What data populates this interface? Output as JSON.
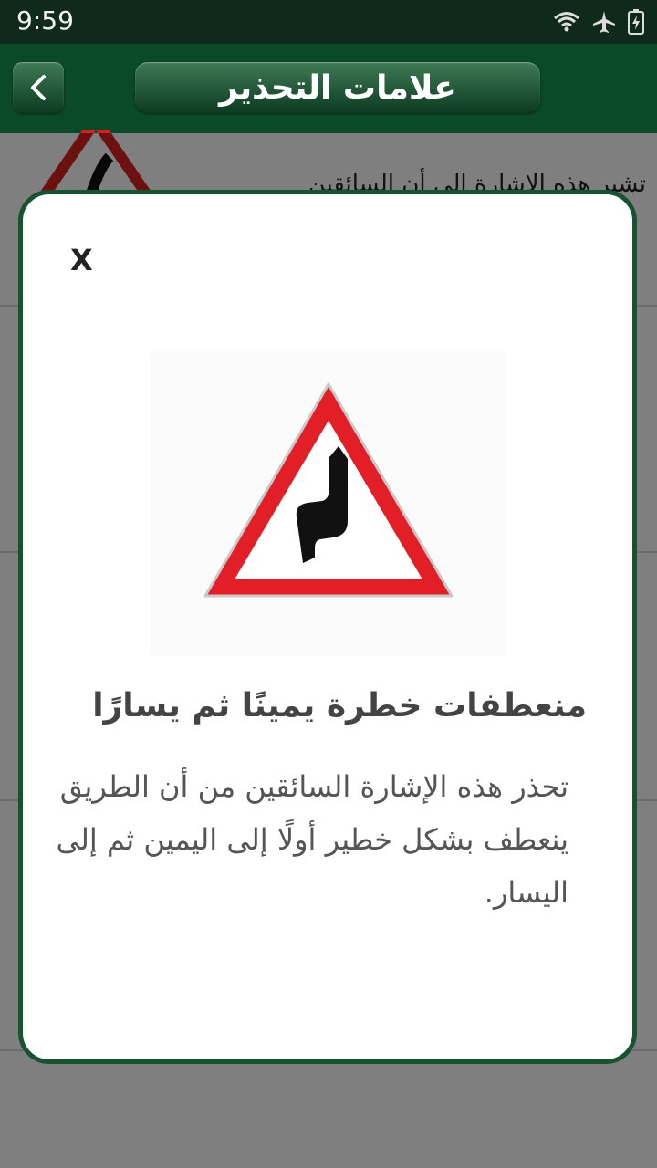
{
  "status_bar": {
    "time": "9:59",
    "icons": [
      "wifi-icon",
      "airplane-mode-icon",
      "battery-charging-icon"
    ]
  },
  "app_bar": {
    "title": "علامات التحذير",
    "back_icon": "chevron-left-icon",
    "color": "#0a4a28"
  },
  "background_list": {
    "items": [
      {
        "desc": "تشير هذه الإشارة إلى أن السائقين"
      },
      {
        "desc": ""
      },
      {
        "desc": ""
      },
      {
        "desc": ""
      }
    ]
  },
  "dialog": {
    "close_label": "X",
    "sign_icon": "double-curve-right-then-left-warning-sign",
    "title": "منعطفات خطرة يمينًا ثم يسارًا",
    "description": "تحذر هذه الإشارة السائقين من أن الطريق ينعطف بشكل خطير أولًا إلى اليمين ثم إلى اليسار.",
    "border_color": "#17532f"
  }
}
